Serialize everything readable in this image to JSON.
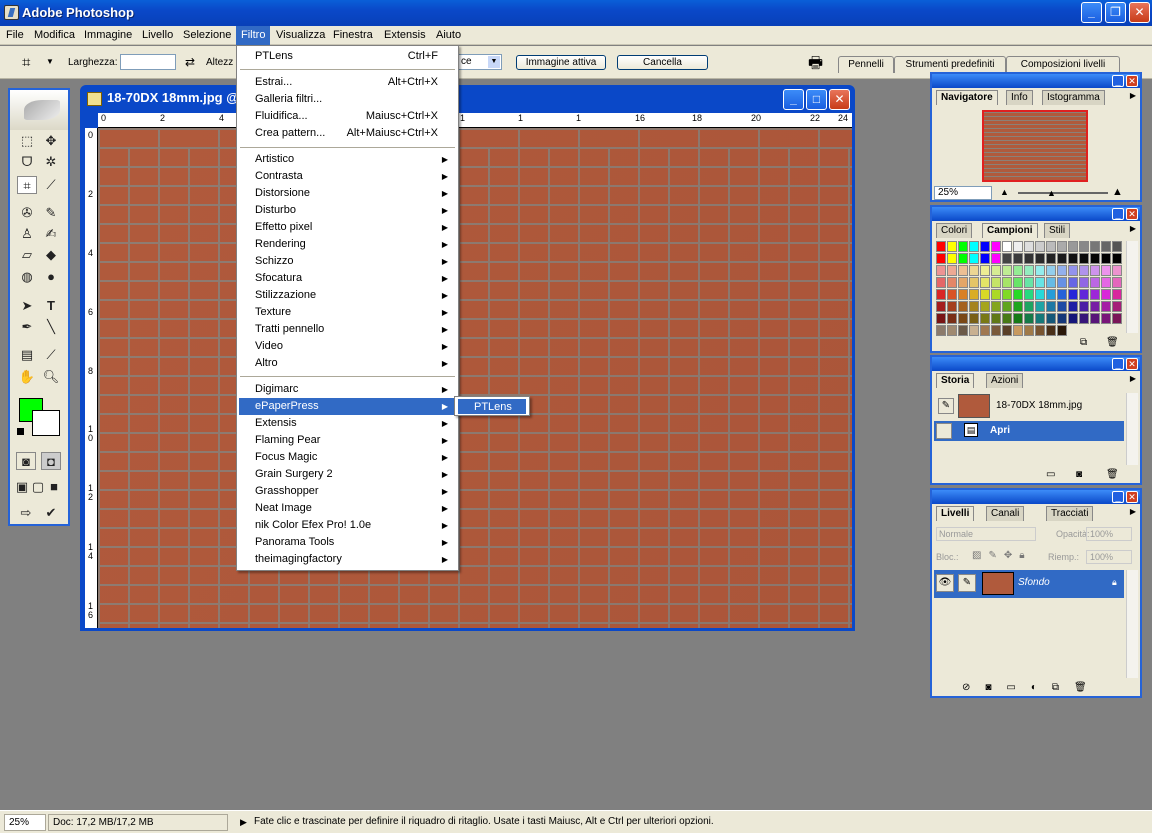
{
  "app": {
    "title": "Adobe Photoshop"
  },
  "menubar": [
    "File",
    "Modifica",
    "Immagine",
    "Livello",
    "Selezione",
    "Filtro",
    "Visualizza",
    "Finestra",
    "Extensis",
    "Aiuto"
  ],
  "options": {
    "width_label": "Larghezza:",
    "height_label": "Altezz",
    "front_image": "Immagine attiva",
    "clear": "Cancella",
    "resolution_fragment": "ce"
  },
  "palette_well": [
    "Pennelli",
    "Strumenti predefiniti",
    "Composizioni livelli"
  ],
  "document": {
    "title": "18-70DX 18mm.jpg @",
    "ruler_h": [
      "0",
      "2",
      "4",
      "",
      "",
      "",
      "",
      "16",
      "18",
      "20",
      "22",
      "24"
    ],
    "ruler_v": [
      "0",
      "2",
      "4",
      "6",
      "8",
      "1\n0",
      "1\n2",
      "1\n4",
      "1\n6"
    ]
  },
  "filter_menu": {
    "last": {
      "label": "PTLens",
      "shortcut": "Ctrl+F"
    },
    "group1": [
      {
        "label": "Estrai...",
        "shortcut": "Alt+Ctrl+X"
      },
      {
        "label": "Galleria filtri...",
        "shortcut": ""
      },
      {
        "label": "Fluidifica...",
        "shortcut": "Maiusc+Ctrl+X"
      },
      {
        "label": "Crea pattern...",
        "shortcut": "Alt+Maiusc+Ctrl+X"
      }
    ],
    "group2": [
      "Artistico",
      "Contrasta",
      "Distorsione",
      "Disturbo",
      "Effetto pixel",
      "Rendering",
      "Schizzo",
      "Sfocatura",
      "Stilizzazione",
      "Texture",
      "Tratti pennello",
      "Video",
      "Altro"
    ],
    "group3": [
      "Digimarc",
      "ePaperPress",
      "Extensis",
      "Flaming Pear",
      "Focus Magic",
      "Grain Surgery 2",
      "Grasshopper",
      "Neat Image",
      "nik Color Efex Pro! 1.0e",
      "Panorama Tools",
      "theimagingfactory"
    ],
    "submenu": [
      "PTLens"
    ]
  },
  "navigator": {
    "tabs": [
      "Navigatore",
      "Info",
      "Istogramma"
    ],
    "zoom": "25%"
  },
  "swatches": {
    "tabs": [
      "Colori",
      "Campioni",
      "Stili"
    ]
  },
  "history": {
    "tabs": [
      "Storia",
      "Azioni"
    ],
    "snapshot": "18-70DX 18mm.jpg",
    "step": "Apri"
  },
  "layers": {
    "tabs": [
      "Livelli",
      "Canali",
      "Tracciati"
    ],
    "blend": "Normale",
    "opacity_label": "Opacità:",
    "opacity": "100%",
    "lock_label": "Bloc.:",
    "fill_label": "Riemp.:",
    "fill": "100%",
    "layer_name": "Sfondo"
  },
  "status": {
    "zoom": "25%",
    "doc": "Doc: 17,2 MB/17,2 MB",
    "hint": "Fate clic e trascinate per definire il riquadro di ritaglio. Usate i tasti Maiusc, Alt e Ctrl per ulteriori opzioni."
  },
  "colors": {
    "foreground": "#00ff00",
    "background": "#ffffff",
    "menu_highlight": "#316ac5"
  }
}
